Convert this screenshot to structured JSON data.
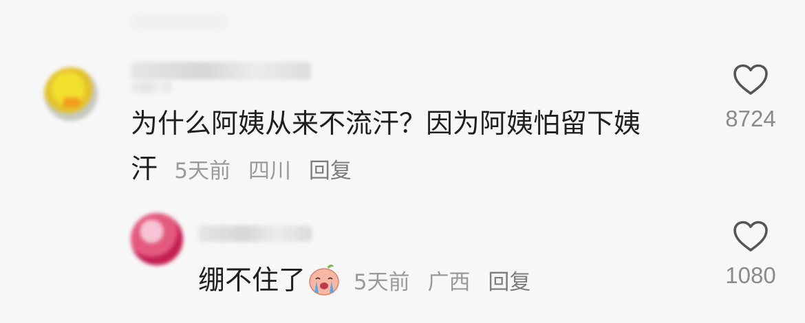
{
  "comments": [
    {
      "text_line1": "为什么阿姨从来不流汗？因为阿姨怕留下姨",
      "text_line2": "汗",
      "time": "5天前",
      "location": "四川",
      "reply_label": "回复",
      "likes": "8724"
    },
    {
      "text": "绷不住了",
      "emoji": "crying-face-emoji",
      "time": "5天前",
      "location": "广西",
      "reply_label": "回复",
      "likes": "1080"
    }
  ],
  "icons": {
    "like": "heart-outline-icon"
  },
  "colors": {
    "background": "#f7f7f7",
    "text": "#1f1f1f",
    "meta": "#9a9a9a",
    "icon": "#555555"
  }
}
